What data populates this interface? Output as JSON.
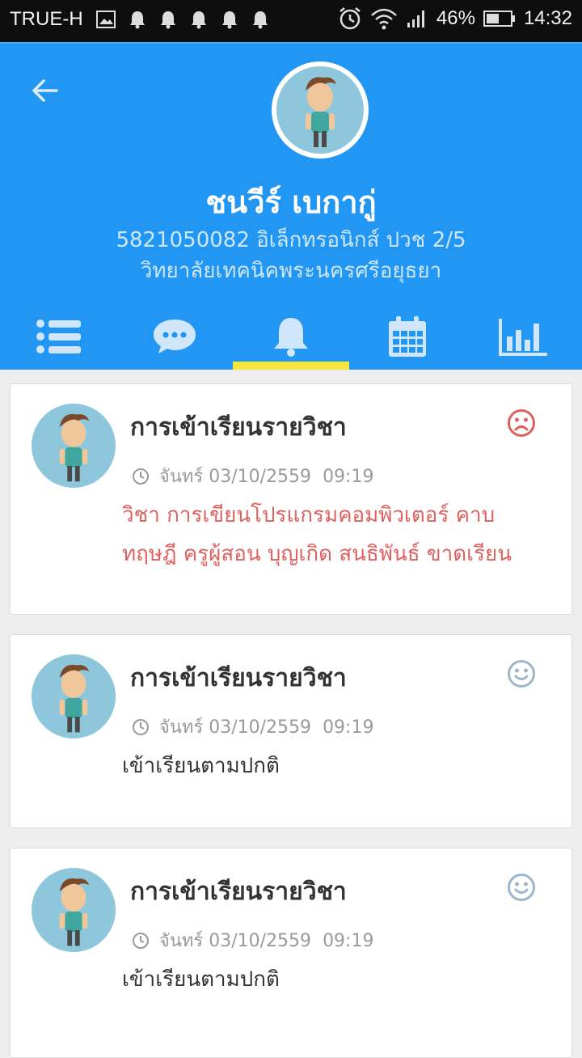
{
  "status_bar": {
    "carrier": "TRUE-H",
    "battery": "46%",
    "time": "14:32"
  },
  "profile": {
    "name": "ชนวีร์ เบกากู่",
    "info_line": "5821050082 อิเล็กทรอนิกส์ ปวช 2/5",
    "school": "วิทยาลัยเทคนิคพระนครศรีอยุธยา"
  },
  "tabs": [
    {
      "name": "list-icon",
      "active": false
    },
    {
      "name": "chat-bubble-icon",
      "active": false
    },
    {
      "name": "bell-icon",
      "active": true
    },
    {
      "name": "calendar-icon",
      "active": false
    },
    {
      "name": "bar-chart-icon",
      "active": false
    }
  ],
  "colors": {
    "header_blue": "#2196f3",
    "tab_indicator": "#f6e53b",
    "alert_red": "#e06060",
    "neutral_icon": "#9eb4c8"
  },
  "notifications": [
    {
      "title": "การเข้าเรียนรายวิชา",
      "day": "จันทร์",
      "date": "03/10/2559",
      "time": "09:19",
      "mood": "sad-face-icon",
      "message_lines": [
        "วิชา การเขียนโปรแกรมคอมพิวเตอร์ คาบ",
        "ทฤษฎี ครูผู้สอน บุญเกิด สนธิพันธ์ ขาดเรียน"
      ],
      "alert": true
    },
    {
      "title": "การเข้าเรียนรายวิชา",
      "day": "จันทร์",
      "date": "03/10/2559",
      "time": "09:19",
      "mood": "happy-face-icon",
      "message_lines": [
        "เข้าเรียนตามปกติ"
      ],
      "alert": false
    },
    {
      "title": "การเข้าเรียนรายวิชา",
      "day": "จันทร์",
      "date": "03/10/2559",
      "time": "09:19",
      "mood": "happy-face-icon",
      "message_lines": [
        "เข้าเรียนตามปกติ"
      ],
      "alert": false
    }
  ]
}
